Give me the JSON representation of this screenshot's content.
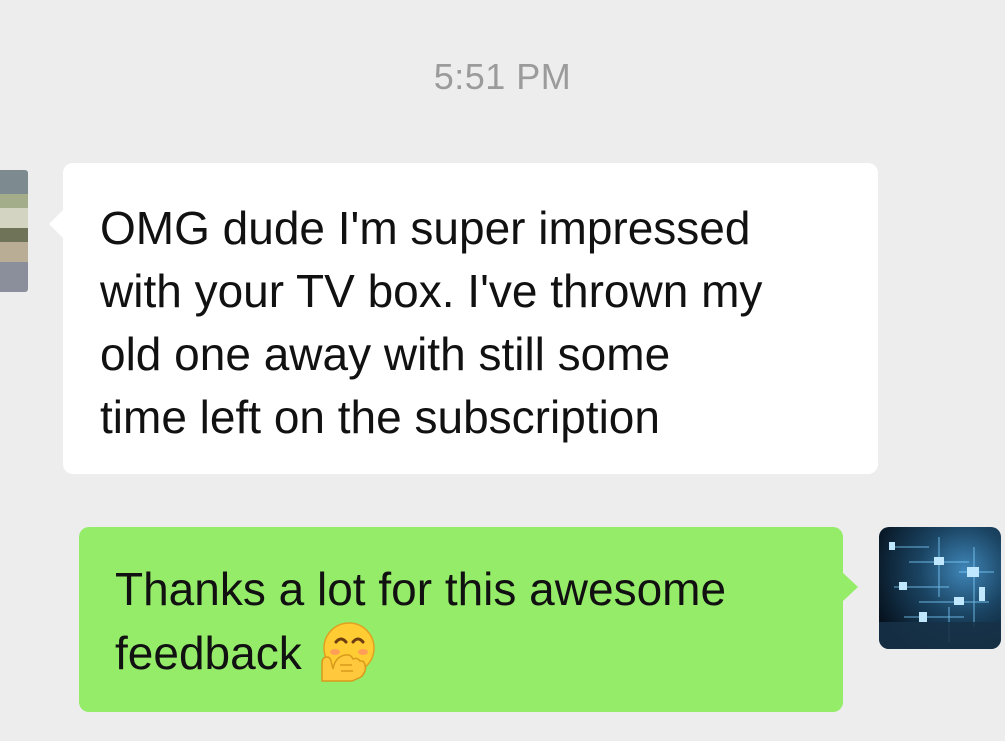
{
  "chat": {
    "timestamp": "5:51 PM",
    "incoming": {
      "text": "OMG dude I'm super impressed\nwith your TV box. I've thrown my\nold one away with still some\ntime left on the subscription"
    },
    "outgoing": {
      "text": "Thanks a lot for this awesome\nfeedback",
      "emoji": "face-with-hand-over-mouth-icon"
    }
  },
  "colors": {
    "background": "#ededed",
    "incoming_bubble": "#ffffff",
    "outgoing_bubble": "#95ec69",
    "timestamp_text": "#9b9b9b",
    "message_text": "#111111"
  }
}
